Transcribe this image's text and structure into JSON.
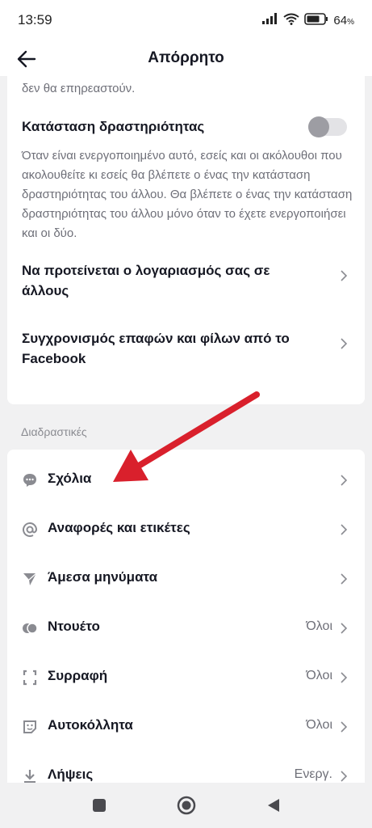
{
  "status_bar": {
    "time": "13:59",
    "battery": "64"
  },
  "header": {
    "title": "Απόρρητο"
  },
  "top_card": {
    "cut_text": "παρακολουθούν τα βίντεό σας. Οι ακόλουθοι που έχετε ήδη δεν θα επηρεαστούν.",
    "activity_status": {
      "title": "Κατάσταση δραστηριότητας",
      "description": "Όταν είναι ενεργοποιημένο αυτό, εσείς και οι ακόλουθοι που ακολουθείτε κι εσείς θα βλέπετε ο ένας την κατάσταση δραστηριότητας του άλλου. Θα βλέπετε ο ένας την κατάσταση δραστηριότητας του άλλου μόνο όταν το έχετε ενεργοποιήσει και οι δύο.",
      "enabled": false
    },
    "suggest_account": {
      "title": "Να προτείνεται ο λογαριασμός σας σε άλλους"
    },
    "sync_contacts": {
      "title": "Συγχρονισμός επαφών και φίλων από το Facebook"
    }
  },
  "interactions": {
    "section_label": "Διαδραστικές",
    "items": [
      {
        "label": "Σχόλια",
        "value": "",
        "icon": "comment-icon"
      },
      {
        "label": "Αναφορές και ετικέτες",
        "value": "",
        "icon": "at-icon"
      },
      {
        "label": "Άμεσα μηνύματα",
        "value": "",
        "icon": "send-icon"
      },
      {
        "label": "Ντουέτο",
        "value": "Όλοι",
        "icon": "duet-icon"
      },
      {
        "label": "Συρραφή",
        "value": "Όλοι",
        "icon": "stitch-icon"
      },
      {
        "label": "Αυτοκόλλητα",
        "value": "Όλοι",
        "icon": "sticker-icon"
      },
      {
        "label": "Λήψεις",
        "value": "Ενεργ.",
        "icon": "download-icon"
      }
    ]
  },
  "colors": {
    "annotation_arrow": "#d9202c",
    "toggle_off": "#9d9da3"
  }
}
